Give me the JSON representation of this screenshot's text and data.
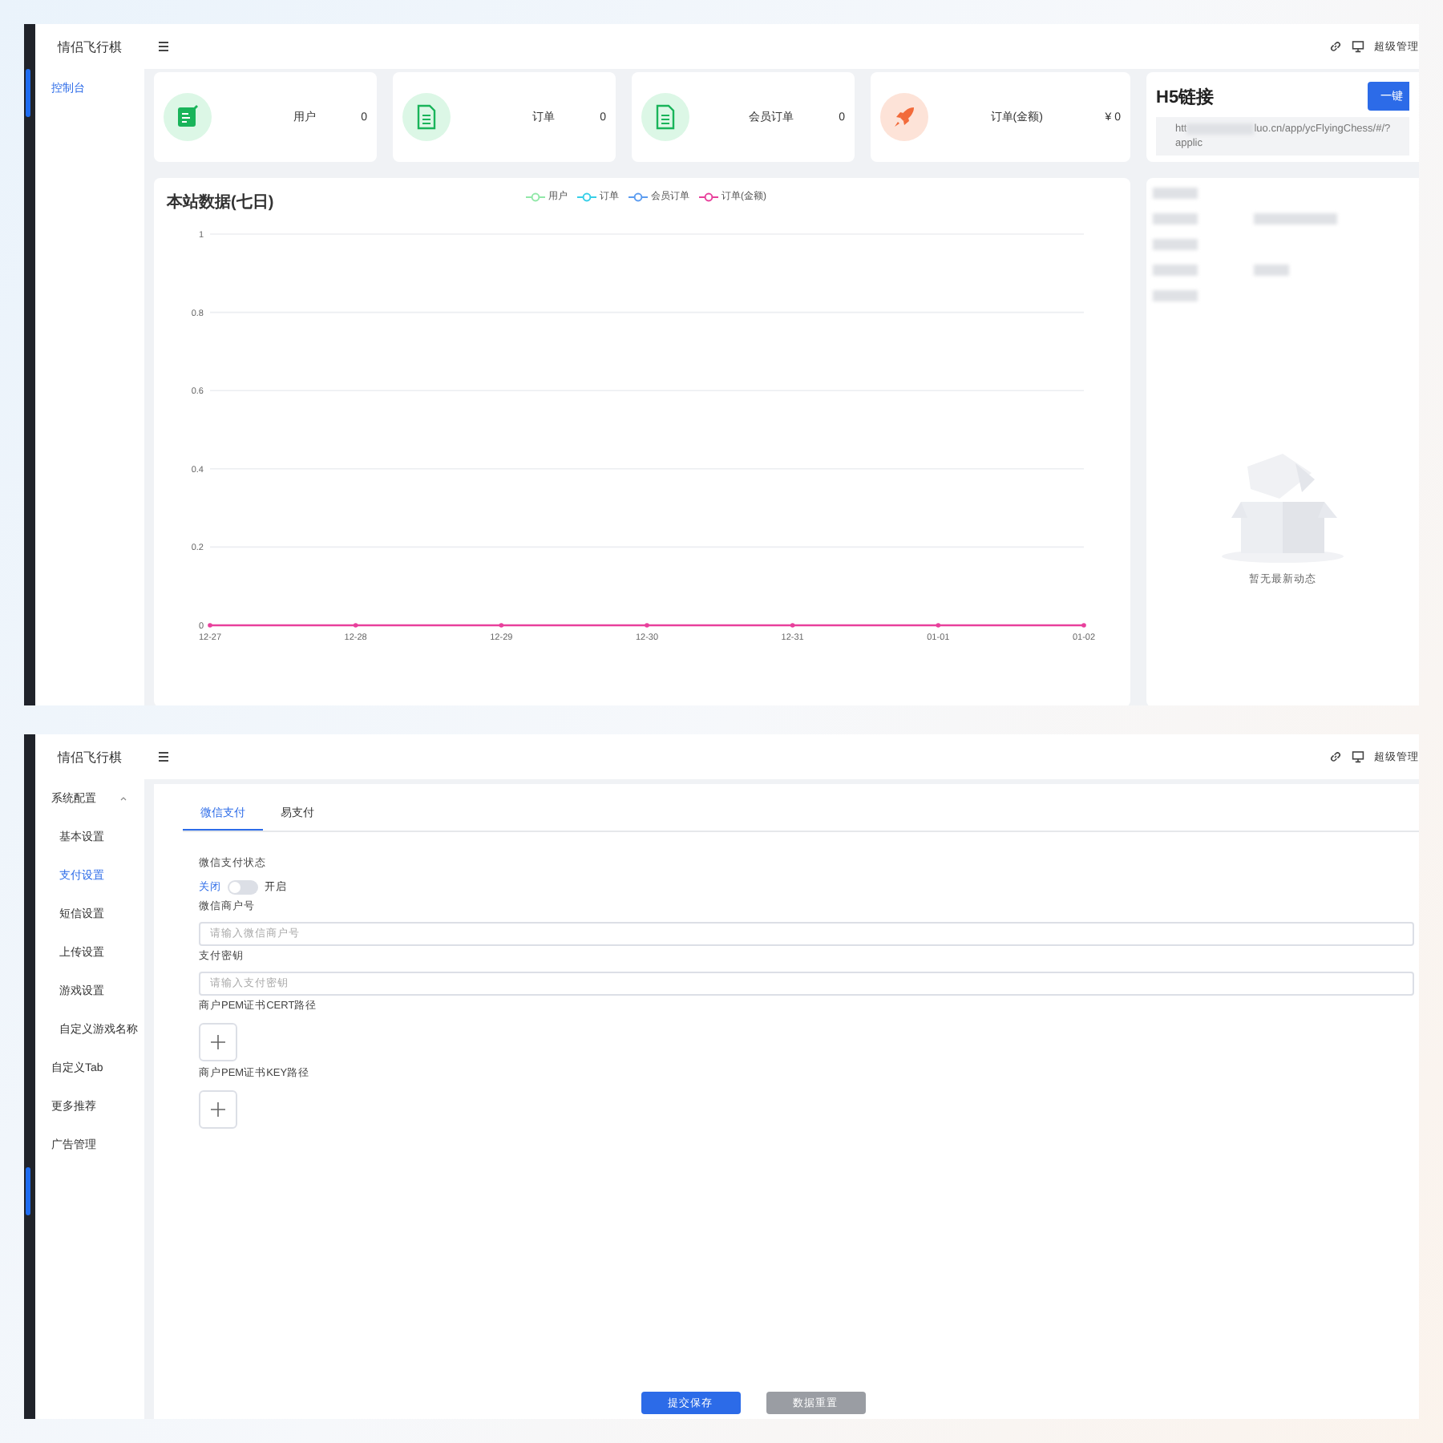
{
  "dashboard": {
    "app_title": "情侣飞行棋",
    "header_user": "超级管理",
    "sidebar": [
      {
        "label": "控制台",
        "selected": true
      }
    ],
    "stats": [
      {
        "kind": "edit",
        "label": "用户",
        "value": "0"
      },
      {
        "kind": "document",
        "label": "订单",
        "value": "0"
      },
      {
        "kind": "document",
        "label": "会员订单",
        "value": "0"
      },
      {
        "kind": "rocket",
        "label": "订单(金额)",
        "value": "¥ 0"
      }
    ],
    "h5_link": {
      "title": "H5链接",
      "button": "一键",
      "url_start": "htt",
      "url_end": "luo.cn/app/ycFlyingChess/#/?",
      "url_line2": "applic"
    },
    "activity": {
      "empty_text": "暂无最新动态"
    },
    "chart": {
      "title": "本站数据(七日)",
      "chart_data": {
        "type": "line",
        "categories": [
          "12-27",
          "12-28",
          "12-29",
          "12-30",
          "12-31",
          "01-01",
          "01-02"
        ],
        "series": [
          {
            "name": "用户",
            "color": "#91e8a8",
            "values": [
              null,
              null,
              null,
              null,
              null,
              null,
              null
            ]
          },
          {
            "name": "订单",
            "color": "#36cfe8",
            "values": [
              null,
              null,
              null,
              null,
              null,
              null,
              null
            ]
          },
          {
            "name": "会员订单",
            "color": "#5b9cf0",
            "values": [
              null,
              null,
              null,
              null,
              null,
              null,
              null
            ]
          },
          {
            "name": "订单(金额)",
            "color": "#e8409c",
            "values": [
              0,
              0,
              0,
              0,
              0,
              0,
              0
            ]
          }
        ],
        "ylim": [
          0,
          1
        ],
        "grid": true,
        "yticks": [
          0,
          0.2,
          0.4,
          0.6,
          0.8,
          1
        ]
      }
    }
  },
  "payment_settings": {
    "app_title": "情侣飞行棋",
    "header_user": "超级管理",
    "sidebar": [
      {
        "label": "系统配置",
        "expanded": true,
        "children": [
          {
            "label": "基本设置",
            "selected": false
          },
          {
            "label": "支付设置",
            "selected": true
          },
          {
            "label": "短信设置",
            "selected": false
          },
          {
            "label": "上传设置",
            "selected": false
          },
          {
            "label": "游戏设置",
            "selected": false
          },
          {
            "label": "自定义游戏名称",
            "selected": false
          }
        ]
      },
      {
        "label": "自定义Tab",
        "selected": false
      },
      {
        "label": "更多推荐",
        "selected": false
      },
      {
        "label": "广告管理",
        "selected": false
      }
    ],
    "tabs": [
      {
        "label": "微信支付",
        "selected": true
      },
      {
        "label": "易支付",
        "selected": false
      }
    ],
    "form": [
      {
        "kind": "switch",
        "label": "微信支付状态",
        "off_label": "关闭",
        "on_label": "开启",
        "on": false
      },
      {
        "kind": "input",
        "label": "微信商户号",
        "placeholder": "请输入微信商户号"
      },
      {
        "kind": "input",
        "label": "支付密钥",
        "placeholder": "请输入支付密钥"
      },
      {
        "kind": "upload",
        "label": "商户PEM证书CERT路径"
      },
      {
        "kind": "upload",
        "label": "商户PEM证书KEY路径"
      }
    ],
    "buttons": [
      {
        "label": "提交保存",
        "kind": "primary"
      },
      {
        "label": "数据重置",
        "kind": "secondary"
      }
    ]
  }
}
